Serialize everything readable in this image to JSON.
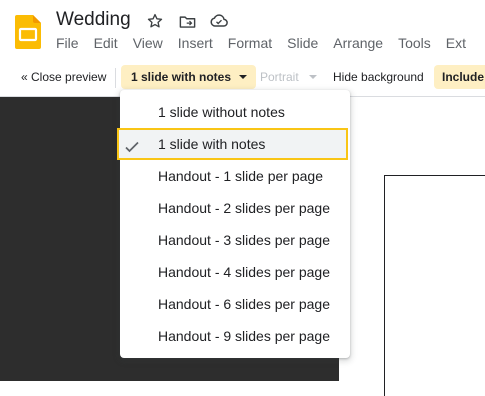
{
  "app": {
    "title": "Wedding",
    "brand_color": "#fbbc04"
  },
  "menubar": {
    "items": [
      "File",
      "Edit",
      "View",
      "Insert",
      "Format",
      "Slide",
      "Arrange",
      "Tools",
      "Ext"
    ]
  },
  "toolbar": {
    "close_preview": "« Close preview",
    "layout_selected": "1 slide with notes",
    "orientation": "Portrait",
    "hide_background": "Hide background",
    "include": "Include s"
  },
  "layout_menu": {
    "options": [
      "1 slide without notes",
      "1 slide with notes",
      "Handout - 1 slide per page",
      "Handout - 2 slides per page",
      "Handout - 3 slides per page",
      "Handout - 4 slides per page",
      "Handout - 6 slides per page",
      "Handout - 9 slides per page"
    ],
    "selected_index": 1,
    "highlight_color": "#f9c515"
  },
  "icons": {
    "app": "slides-app-icon",
    "star": "star-icon",
    "move": "move-to-folder-icon",
    "cloud": "cloud-saved-icon",
    "check": "check-icon"
  }
}
